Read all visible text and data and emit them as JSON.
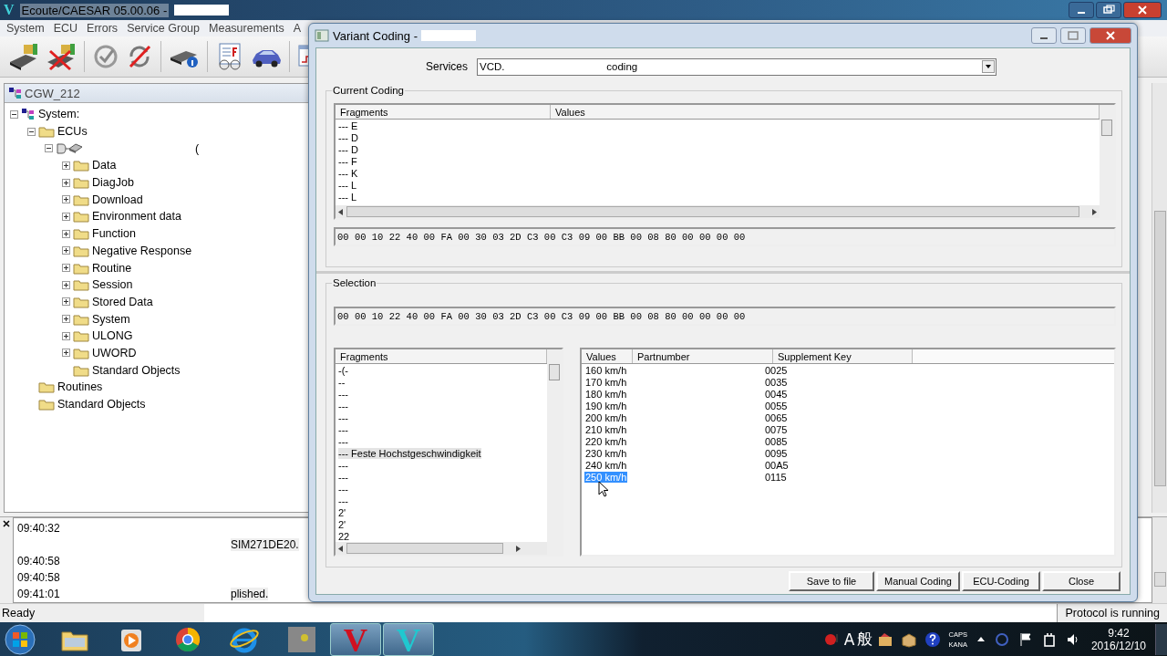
{
  "app": {
    "icon_letter": "V",
    "title": "Ecoute/CAESAR 05.00.06 -",
    "menu": [
      "System",
      "ECU",
      "Errors",
      "Service Group",
      "Measurements",
      "A"
    ],
    "toolbar": [
      {
        "kind": "connect"
      },
      {
        "kind": "disconnect"
      },
      {
        "kind": "check"
      },
      {
        "kind": "sync-off"
      },
      {
        "kind": "device-info"
      },
      {
        "kind": "document"
      },
      {
        "kind": "car"
      },
      {
        "kind": "chart"
      }
    ]
  },
  "panel": {
    "title": "CGW_212",
    "tree": [
      {
        "label": "System:",
        "kind": "system",
        "expanded": true,
        "children": [
          {
            "label": "ECUs",
            "kind": "folder",
            "expanded": true,
            "children": [
              {
                "label": "(",
                "kind": "ecu",
                "expanded": true,
                "children": [
                  {
                    "label": "Data",
                    "kind": "folder",
                    "expanded": false
                  },
                  {
                    "label": "DiagJob",
                    "kind": "folder",
                    "expanded": false
                  },
                  {
                    "label": "Download",
                    "kind": "folder",
                    "expanded": false
                  },
                  {
                    "label": "Environment data",
                    "kind": "folder",
                    "expanded": false
                  },
                  {
                    "label": "Function",
                    "kind": "folder",
                    "expanded": false
                  },
                  {
                    "label": "Negative Response",
                    "kind": "folder",
                    "expanded": false
                  },
                  {
                    "label": "Routine",
                    "kind": "folder",
                    "expanded": false
                  },
                  {
                    "label": "Session",
                    "kind": "folder",
                    "expanded": false
                  },
                  {
                    "label": "Stored Data",
                    "kind": "folder",
                    "expanded": false
                  },
                  {
                    "label": "System",
                    "kind": "folder",
                    "expanded": false
                  },
                  {
                    "label": "ULONG",
                    "kind": "folder",
                    "expanded": false
                  },
                  {
                    "label": "UWORD",
                    "kind": "folder",
                    "expanded": false
                  },
                  {
                    "label": "Standard Objects",
                    "kind": "folder"
                  }
                ]
              }
            ]
          },
          {
            "label": "Routines",
            "kind": "folder"
          },
          {
            "label": "Standard Objects",
            "kind": "folder"
          }
        ]
      }
    ]
  },
  "log": [
    {
      "time": "09:40:32"
    },
    {
      "message": "SIM271DE20."
    },
    {
      "time": "09:40:58"
    },
    {
      "time": "09:40:58"
    },
    {
      "time": "09:41:01",
      "message": "plished."
    }
  ],
  "status": {
    "text": "Ready",
    "protocol": "Protocol is running"
  },
  "dialog": {
    "title": "Variant Coding -",
    "services": {
      "label": "Services",
      "value": "VCD.                                   coding"
    },
    "current": {
      "title": "Current Coding",
      "columns": [
        "Fragments",
        "Values"
      ],
      "rows": [
        "--- E",
        "--- D",
        "--- D",
        "--- F",
        "--- K",
        "--- L",
        "--- L"
      ],
      "hex": "00 00 10 22 40 00 FA 00 30 03 2D C3 00 C3 09 00 BB 00 08 80 00 00 00 00"
    },
    "selection": {
      "title": "Selection",
      "hex": "00 00 10 22 40 00 FA 00 30 03 2D C3 00 C3 09 00 BB 00 08 80 00 00 00 00",
      "fragments": {
        "title": "Fragments",
        "items": [
          {
            "text": "-(-",
            "selected": false
          },
          {
            "text": "--",
            "selected": false
          },
          {
            "text": "---",
            "selected": false
          },
          {
            "text": "---",
            "selected": false
          },
          {
            "text": "---",
            "selected": false
          },
          {
            "text": "---",
            "selected": false
          },
          {
            "text": "---",
            "selected": false
          },
          {
            "text": "--- Feste Hochstgeschwindigkeit",
            "selected": true
          },
          {
            "text": "---",
            "selected": false
          },
          {
            "text": "---",
            "selected": false
          },
          {
            "text": "---",
            "selected": false
          },
          {
            "text": "---",
            "selected": false
          },
          {
            "text": "2'",
            "selected": false
          },
          {
            "text": "2'",
            "selected": false
          },
          {
            "text": "22",
            "selected": false
          }
        ]
      },
      "values": {
        "columns": [
          "Values",
          "Partnumber",
          "Supplement Key"
        ],
        "rows": [
          {
            "value": "160 km/h",
            "key": "0025",
            "selected": false
          },
          {
            "value": "170 km/h",
            "key": "0035",
            "selected": false
          },
          {
            "value": "180 km/h",
            "key": "0045",
            "selected": false
          },
          {
            "value": "190 km/h",
            "key": "0055",
            "selected": false
          },
          {
            "value": "200 km/h",
            "key": "0065",
            "selected": false
          },
          {
            "value": "210 km/h",
            "key": "0075",
            "selected": false
          },
          {
            "value": "220 km/h",
            "key": "0085",
            "selected": false
          },
          {
            "value": "230 km/h",
            "key": "0095",
            "selected": false
          },
          {
            "value": "240 km/h",
            "key": "00A5",
            "selected": false
          },
          {
            "value": "250 km/h",
            "key": "0115",
            "selected": true
          }
        ]
      }
    },
    "buttons": [
      "Save to file",
      "Manual Coding",
      "ECU-Coding",
      "Close"
    ]
  },
  "taskbar": {
    "apps": [
      {
        "kind": "folder"
      },
      {
        "kind": "media"
      },
      {
        "kind": "chrome"
      },
      {
        "kind": "ie"
      },
      {
        "kind": "photo"
      },
      {
        "kind": "letter-red",
        "letter": "V",
        "active": true
      },
      {
        "kind": "letter-cyan",
        "letter": "V",
        "active": true
      }
    ],
    "tray": {
      "ime": [
        "A",
        "般"
      ],
      "caps": "CAPS",
      "kana": "KANA",
      "time": "9:42",
      "date": "2016/12/10"
    }
  }
}
